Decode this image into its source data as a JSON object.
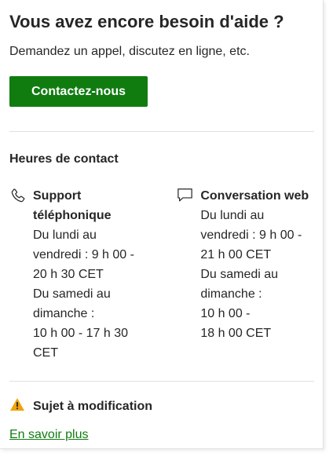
{
  "header": {
    "title": "Vous avez encore besoin d'aide ?",
    "subtitle": "Demandez un appel, discutez en ligne, etc."
  },
  "contact_button": {
    "label": "Contactez-nous"
  },
  "hours": {
    "heading": "Heures de contact",
    "phone": {
      "icon": "phone-icon",
      "title_lines": [
        "Support",
        "téléphonique"
      ],
      "detail_lines": [
        "Du lundi au",
        "vendredi : 9 h 00 -",
        "20 h 30 CET",
        "Du samedi au",
        "dimanche :",
        "10 h 00 - 17 h 30",
        "CET"
      ]
    },
    "chat": {
      "icon": "chat-bubble-icon",
      "title_lines": [
        "Conversation web"
      ],
      "detail_lines": [
        "Du lundi au",
        "vendredi : 9 h 00 -",
        "21 h 00 CET",
        "Du samedi au",
        "dimanche :",
        "10 h 00 -",
        "18 h 00 CET"
      ]
    }
  },
  "notice": {
    "icon": "warning-icon",
    "title": "Sujet à modification",
    "link_label": "En savoir plus"
  },
  "colors": {
    "accent": "#107c10",
    "warning": "#f0a30a",
    "text": "#262626",
    "divider": "#e1e1e1"
  }
}
